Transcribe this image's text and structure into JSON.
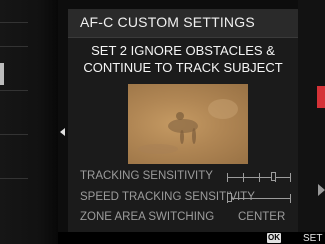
{
  "panel": {
    "title": "AF-C CUSTOM SETTINGS",
    "set_line1": "SET 2 IGNORE OBSTACLES &",
    "set_line2": "CONTINUE TO TRACK SUBJECT"
  },
  "settings": [
    {
      "label": "TRACKING SENSITIVITY",
      "level_fraction": 0.75
    },
    {
      "label": "SPEED TRACKING SENSITIVITY",
      "level_fraction": 0.0
    },
    {
      "label": "ZONE AREA SWITCHING",
      "value": "CENTER"
    }
  ],
  "footer": {
    "ok_label": "OK",
    "set_label": "SET"
  },
  "icons": {
    "left_arrow": "left-arrow-icon",
    "ok": "ok-button-icon"
  },
  "colors": {
    "accent_red": "#d53237",
    "text_primary": "#f0f0f0",
    "text_dim": "#9c9c9c"
  }
}
